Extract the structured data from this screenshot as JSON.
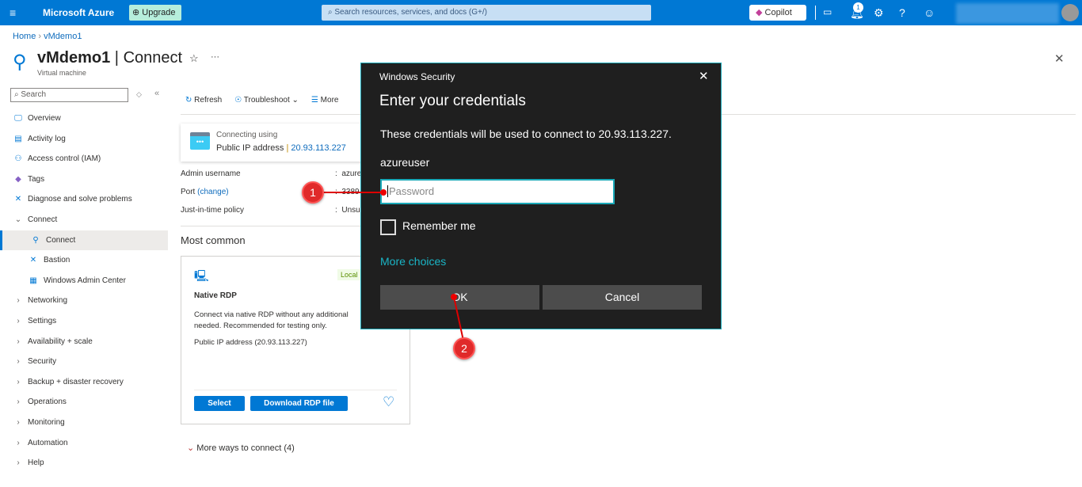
{
  "topbar": {
    "brand": "Microsoft Azure",
    "upgrade": "Upgrade",
    "search_placeholder": "Search resources, services, and docs (G+/)",
    "copilot": "Copilot",
    "notification_count": "1",
    "accent": "#0078d4"
  },
  "breadcrumb": [
    "Home",
    "vMdemo1"
  ],
  "header": {
    "title": "vMdemo1",
    "section": "Connect",
    "subtitle": "Virtual machine"
  },
  "sidebar": {
    "search_placeholder": "Search",
    "items": [
      {
        "label": "Overview",
        "icon": "monitor-icon"
      },
      {
        "label": "Activity log",
        "icon": "log-icon"
      },
      {
        "label": "Access control (IAM)",
        "icon": "people-icon"
      },
      {
        "label": "Tags",
        "icon": "tag-icon"
      },
      {
        "label": "Diagnose and solve problems",
        "icon": "wrench-icon"
      },
      {
        "label": "Connect",
        "icon": "chevron-down-icon",
        "group": true
      },
      {
        "label": "Connect",
        "icon": "plug-icon",
        "sub": true,
        "selected": true
      },
      {
        "label": "Bastion",
        "icon": "bastion-icon",
        "sub": true
      },
      {
        "label": "Windows Admin Center",
        "icon": "server-icon",
        "sub": true
      },
      {
        "label": "Networking",
        "icon": "chevron-right-icon",
        "group": true
      },
      {
        "label": "Settings",
        "icon": "chevron-right-icon",
        "group": true
      },
      {
        "label": "Availability + scale",
        "icon": "chevron-right-icon",
        "group": true
      },
      {
        "label": "Security",
        "icon": "chevron-right-icon",
        "group": true
      },
      {
        "label": "Backup + disaster recovery",
        "icon": "chevron-right-icon",
        "group": true
      },
      {
        "label": "Operations",
        "icon": "chevron-right-icon",
        "group": true
      },
      {
        "label": "Monitoring",
        "icon": "chevron-right-icon",
        "group": true
      },
      {
        "label": "Automation",
        "icon": "chevron-right-icon",
        "group": true
      },
      {
        "label": "Help",
        "icon": "chevron-right-icon",
        "group": true
      }
    ]
  },
  "toolbar": {
    "refresh": "Refresh",
    "troubleshoot": "Troubleshoot",
    "more": "More"
  },
  "connection": {
    "label": "Connecting using",
    "method": "Public IP address",
    "ip": "20.93.113.227"
  },
  "props": [
    {
      "k": "Admin username",
      "v": "azure"
    },
    {
      "k": "Port",
      "link": "(change)",
      "v": "3389"
    },
    {
      "k": "Just-in-time policy",
      "v": "Unsu"
    }
  ],
  "most_common": "Most common",
  "card": {
    "badge": "Local",
    "title": "Native RDP",
    "desc1": "Connect via native RDP without any additional",
    "desc2": "needed. Recommended for testing only.",
    "ip": "Public IP address (20.93.113.227)",
    "select": "Select",
    "download": "Download RDP file"
  },
  "more_ways": "More ways to connect (4)",
  "dialog": {
    "window_title": "Windows Security",
    "heading": "Enter your credentials",
    "message": "These credentials will be used to connect to 20.93.113.227.",
    "username": "azureuser",
    "password_placeholder": "Password",
    "remember": "Remember me",
    "more_choices": "More choices",
    "ok": "OK",
    "cancel": "Cancel"
  },
  "markers": [
    "1",
    "2"
  ]
}
